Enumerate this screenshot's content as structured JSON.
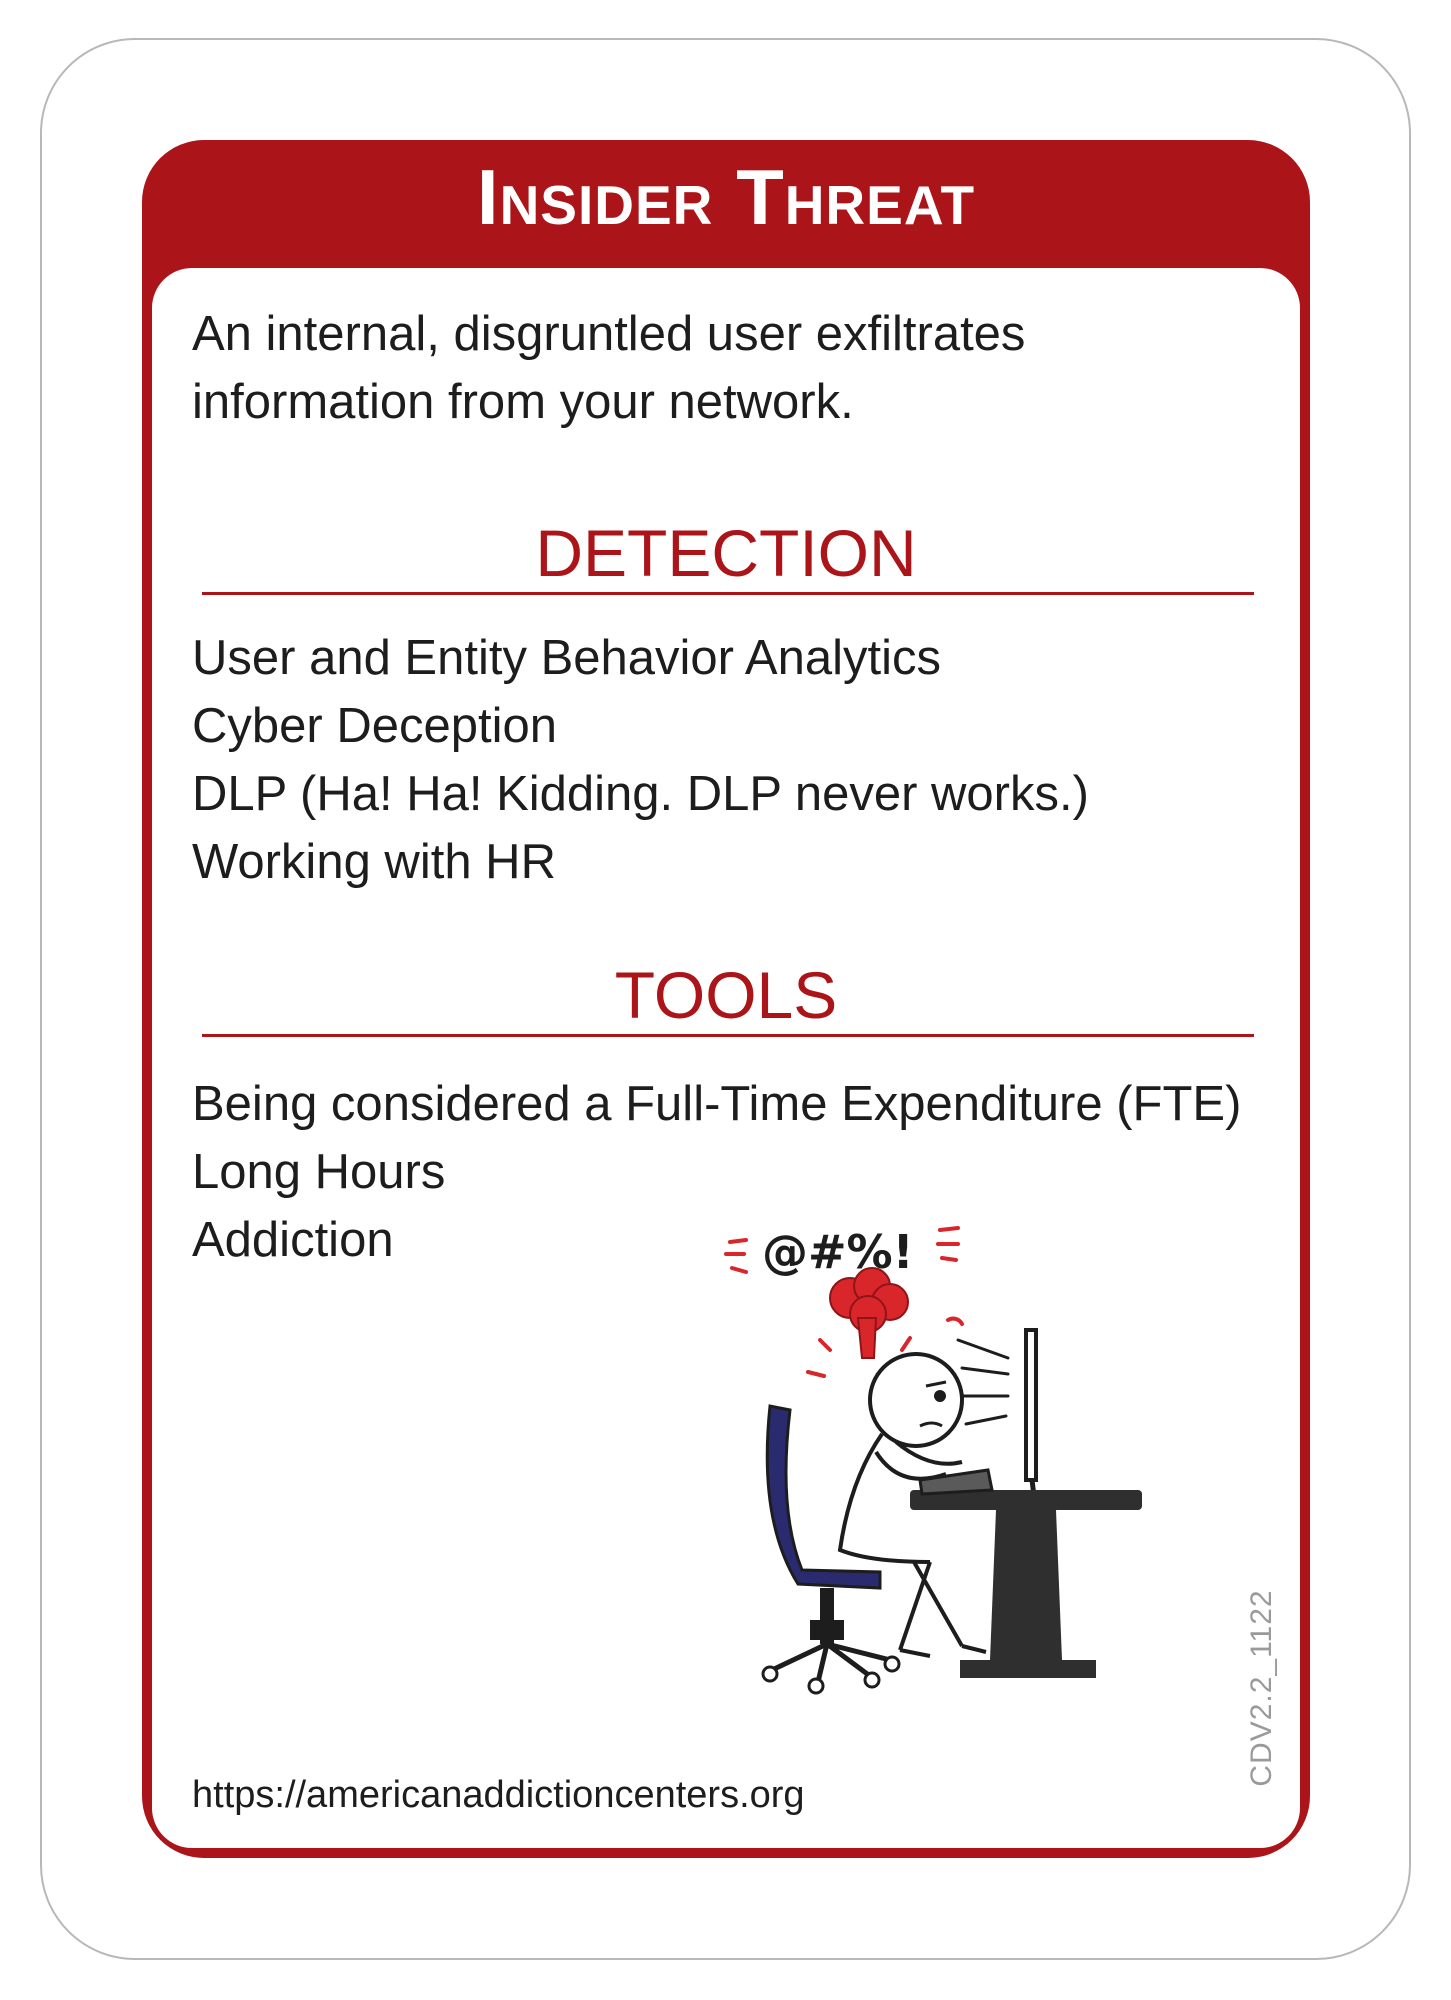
{
  "card": {
    "title": "Insider Threat",
    "description": "An internal, disgruntled user exfiltrates information from your network.",
    "detection": {
      "heading": "DETECTION",
      "items": [
        "User and Entity Behavior Analytics",
        "Cyber Deception",
        "DLP (Ha! Ha! Kidding. DLP never works.)",
        "Working with HR"
      ]
    },
    "tools": {
      "heading": "TOOLS",
      "items": [
        "Being considered a Full-Time Expenditure (FTE)",
        "Long Hours",
        "Addiction"
      ]
    },
    "illustration": {
      "icon": "frustrated-stick-figure-at-computer-icon",
      "symbols": "@#%!"
    },
    "footer_url": "https://americanaddictioncenters.org",
    "card_code": "CDV2.2_1122"
  },
  "colors": {
    "accent": "#ab1519",
    "text": "#1d1d1d",
    "chair": "#2a2a6e",
    "desk": "#2f2f2f",
    "anger": "#d9262b"
  }
}
